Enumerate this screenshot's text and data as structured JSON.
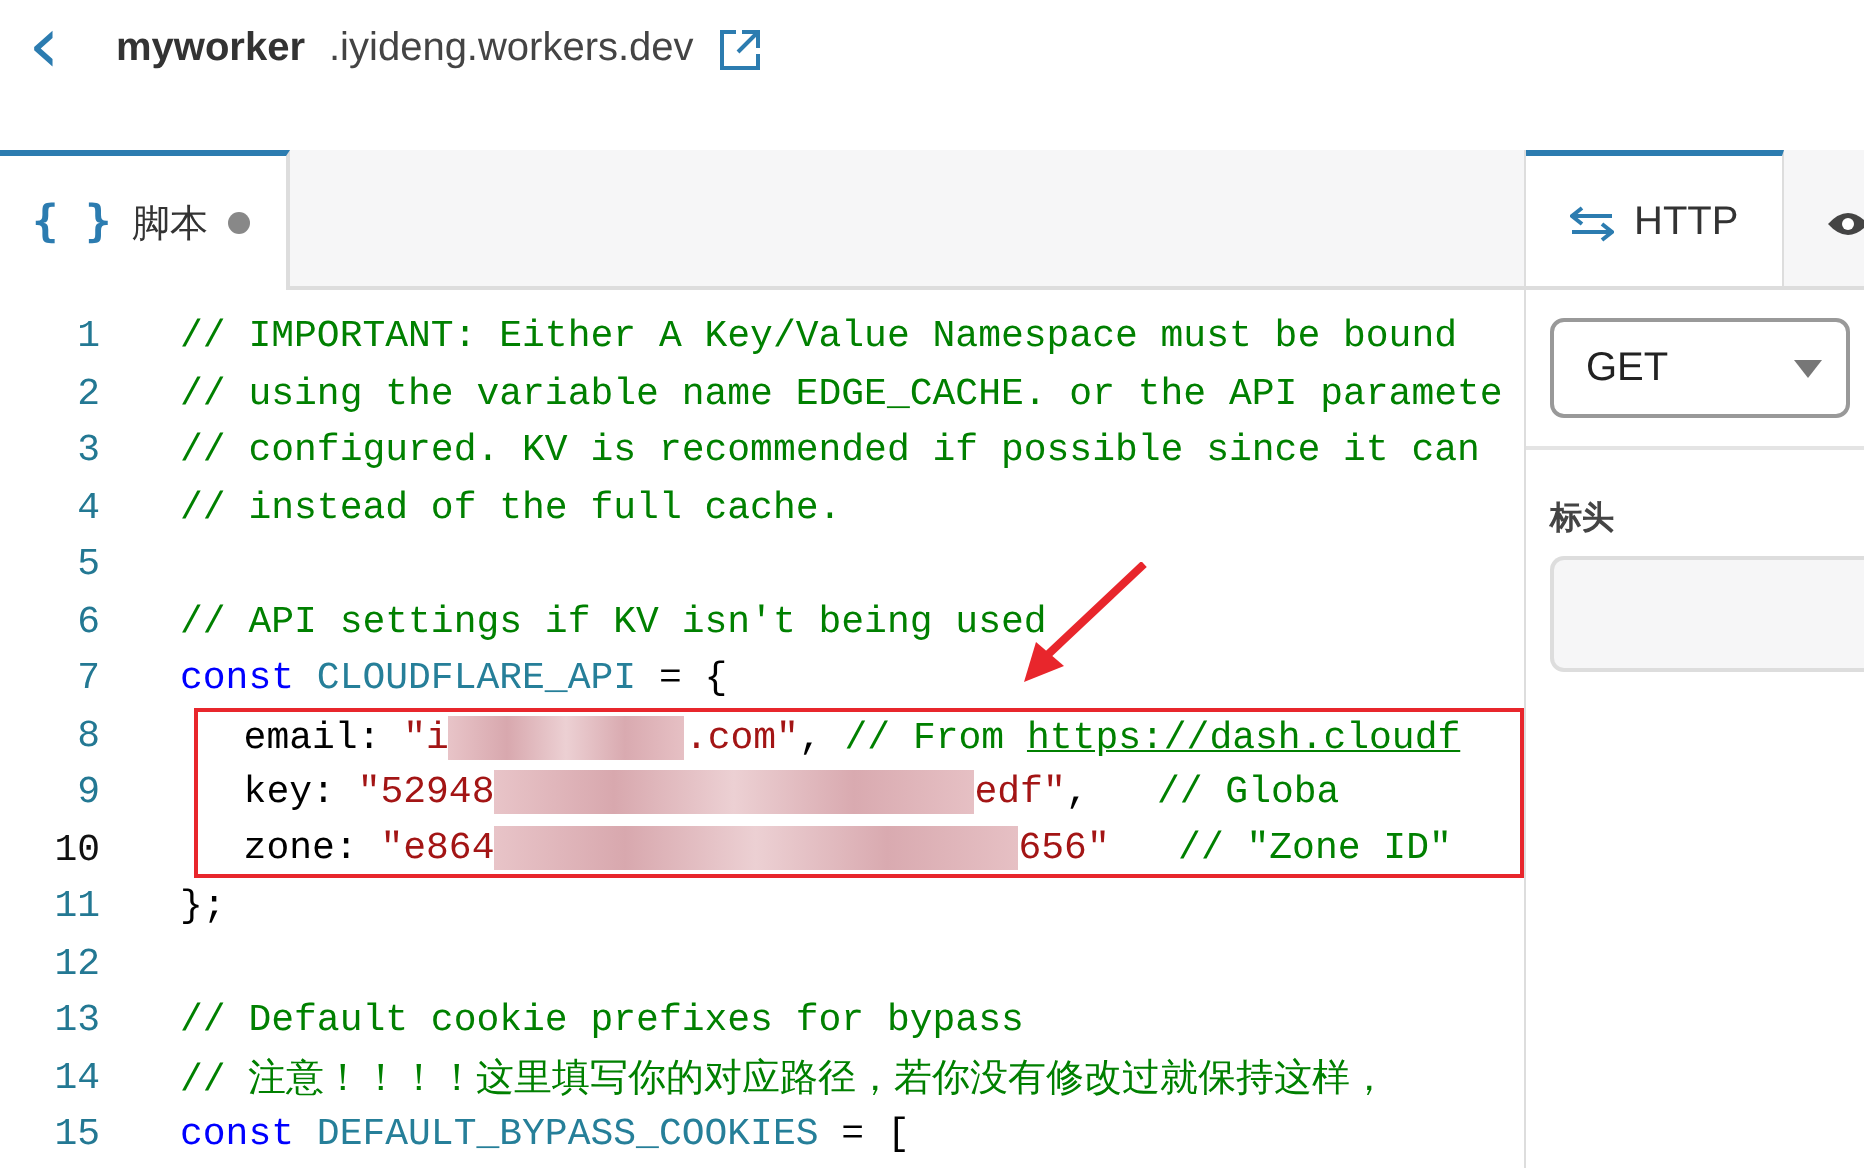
{
  "header": {
    "back": "‹",
    "worker": "myworker",
    "domain": ".iyideng.workers.dev"
  },
  "editor_tabs": [
    {
      "icon": "{ }",
      "label": "脚本",
      "selected": true,
      "modified": true
    }
  ],
  "code": [
    {
      "number": "1",
      "current": false,
      "tokens": [
        {
          "kind": "comment",
          "text": "// IMPORTANT: Either A Key/Value Namespace must be bound"
        }
      ]
    },
    {
      "number": "2",
      "current": false,
      "tokens": [
        {
          "kind": "comment",
          "text": "// using the variable name EDGE_CACHE. or the API paramete"
        }
      ]
    },
    {
      "number": "3",
      "current": false,
      "tokens": [
        {
          "kind": "comment",
          "text": "// configured. KV is recommended if possible since it can"
        }
      ]
    },
    {
      "number": "4",
      "current": false,
      "tokens": [
        {
          "kind": "comment",
          "text": "// instead of the full cache."
        }
      ]
    },
    {
      "number": "5",
      "current": false
    },
    {
      "number": "6",
      "current": false,
      "tokens": [
        {
          "kind": "comment",
          "text": "// API settings if KV isn't being used"
        }
      ]
    },
    {
      "number": "7",
      "current": false,
      "tokens": [
        {
          "kind": "keyword",
          "text": "const"
        },
        {
          "kind": "ident",
          "text": " CLOUDFLARE_API"
        },
        {
          "kind": "plain",
          "text": " = {"
        }
      ]
    },
    {
      "number": "8",
      "current": false,
      "boxed": true,
      "tokens": [
        {
          "kind": "plain",
          "text": "  email: "
        },
        {
          "kind": "string",
          "text": "\"i"
        },
        {
          "kind": "redacted"
        },
        {
          "kind": "string",
          "text": ".com\""
        },
        {
          "kind": "plain",
          "text": ", "
        },
        {
          "kind": "comment",
          "text": "// From "
        },
        {
          "kind": "link",
          "text": "https://dash.cloudf"
        }
      ]
    },
    {
      "number": "9",
      "current": false,
      "boxed": true,
      "tokens": [
        {
          "kind": "plain",
          "text": "  key: "
        },
        {
          "kind": "string",
          "text": "\"52948"
        },
        {
          "kind": "redacted"
        },
        {
          "kind": "string",
          "text": "edf\""
        },
        {
          "kind": "plain",
          "text": ",   "
        },
        {
          "kind": "comment",
          "text": "// Globa"
        }
      ]
    },
    {
      "number": "10",
      "current": true,
      "boxed": true,
      "tokens": [
        {
          "kind": "plain",
          "text": "  zone: "
        },
        {
          "kind": "string",
          "text": "\"e864"
        },
        {
          "kind": "redacted"
        },
        {
          "kind": "string",
          "text": "656\""
        },
        {
          "kind": "comment",
          "text": "   // \"Zone ID\""
        }
      ]
    },
    {
      "number": "11",
      "current": false,
      "tokens": [
        {
          "kind": "plain",
          "text": "};"
        }
      ]
    },
    {
      "number": "12",
      "current": false
    },
    {
      "number": "13",
      "current": false,
      "tokens": [
        {
          "kind": "comment",
          "text": "// Default cookie prefixes for bypass"
        }
      ]
    },
    {
      "number": "14",
      "current": false,
      "tokens": [
        {
          "kind": "comment",
          "text": "// 注意！！！！这里填写你的对应路径，若你没有修改过就保持这样，"
        }
      ]
    },
    {
      "number": "15",
      "current": false,
      "tokens": [
        {
          "kind": "keyword",
          "text": "const"
        },
        {
          "kind": "ident",
          "text": " DEFAULT_BYPASS_COOKIES"
        },
        {
          "kind": "plain",
          "text": " = ["
        }
      ]
    }
  ],
  "side_tabs": [
    {
      "kind": "http",
      "label": "HTTP",
      "selected": true
    },
    {
      "kind": "preview",
      "selected": false
    }
  ],
  "method": {
    "value": "GET"
  },
  "headers_label": "标头"
}
